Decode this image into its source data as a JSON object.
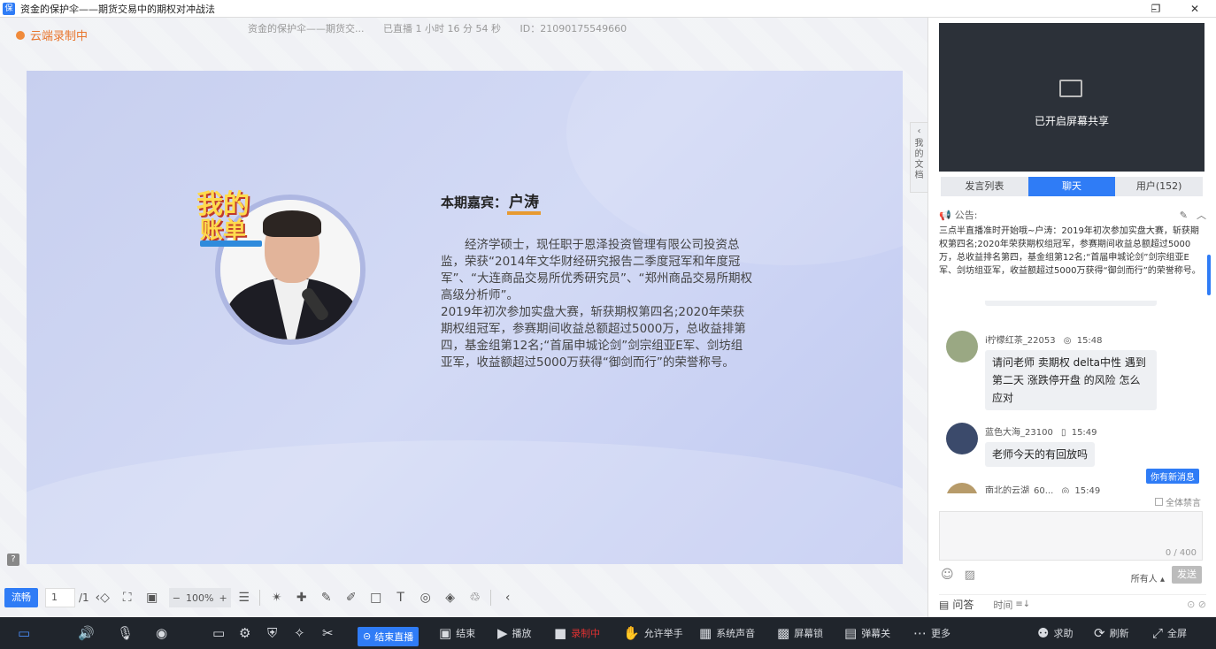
{
  "window": {
    "title": "资金的保护伞——期货交易中的期权对冲战法",
    "logo": "保",
    "controls": [
      "–",
      "❐",
      "✕"
    ]
  },
  "status": {
    "recording": "云端录制中",
    "session_title": "资金的保护伞——期货交...",
    "live_duration": "已直播 1 小时 16 分 54 秒",
    "id": "ID：21090175549660"
  },
  "slide": {
    "badge_line1": "我的",
    "badge_line2": "账单",
    "guest_label": "本期嘉宾：",
    "guest_name": "户涛",
    "bio_p1": "经济学硕士，现任职于恩泽投资管理有限公司投资总监，荣获“2014年文华财经研究报告二季度冠军和年度冠军”、“大连商品交易所优秀研究员”、“郑州商品交易所期权高级分析师”。",
    "bio_p2": "2019年初次参加实盘大赛，斩获期权第四名;2020年荣获期权组冠军，参赛期间收益总额超过5000万，总收益排第四，基金组第12名;“首届申城论剑”剑宗组亚E军、剑坊组亚军，收益额超过5000万获得“御剑而行”的荣誉称号。"
  },
  "doc_tab": "我的文档",
  "slide_toolbar": {
    "mode": "流畅",
    "page": "1",
    "total": "/1",
    "zoom": "100%"
  },
  "video": {
    "share_text": "已开启屏幕共享"
  },
  "tabs": [
    "发言列表",
    "聊天",
    "用户(152)"
  ],
  "notice": {
    "label": "公告:",
    "text": "三点半直播准时开始哦~户涛：2019年初次参加实盘大赛，斩获期权第四名;2020年荣获期权组冠军，参赛期间收益总额超过5000万，总收益排名第四，基金组第12名;“首届申城论剑”剑宗组亚E军、剑坊组亚军，收益额超过5000万获得“御剑而行”的荣誉称号。"
  },
  "messages": [
    {
      "user": "i柠檬红茶_22053",
      "time": "15:48",
      "text": "请问老师 卖期权 delta中性 遇到 第二天 涨跌停开盘 的风险 怎么应对",
      "avatar_color": "#9aa883"
    },
    {
      "user": "蓝色大海_23100",
      "time": "15:49",
      "text": "老师今天的有回放吗",
      "avatar_color": "#3b4a6b"
    },
    {
      "user": "南北的云湖_60...",
      "time": "15:49",
      "text": "",
      "avatar_color": "#b79b6a"
    }
  ],
  "new_message": "你有新消息",
  "mute_all": "全体禁言",
  "input": {
    "count": "0 / 400"
  },
  "send": {
    "to": "所有人",
    "label": "发送"
  },
  "qa": {
    "label": "问答",
    "time": "时间"
  },
  "bottom": {
    "end_live": "结束直播",
    "end": "结束",
    "play": "播放",
    "recording": "录制中",
    "raise_hand": "允许举手",
    "system_sound": "系统声音",
    "screen_lock": "屏幕锁",
    "danmu": "弹幕关",
    "more": "更多",
    "help": "求助",
    "refresh": "刷新",
    "fullscreen": "全屏"
  }
}
